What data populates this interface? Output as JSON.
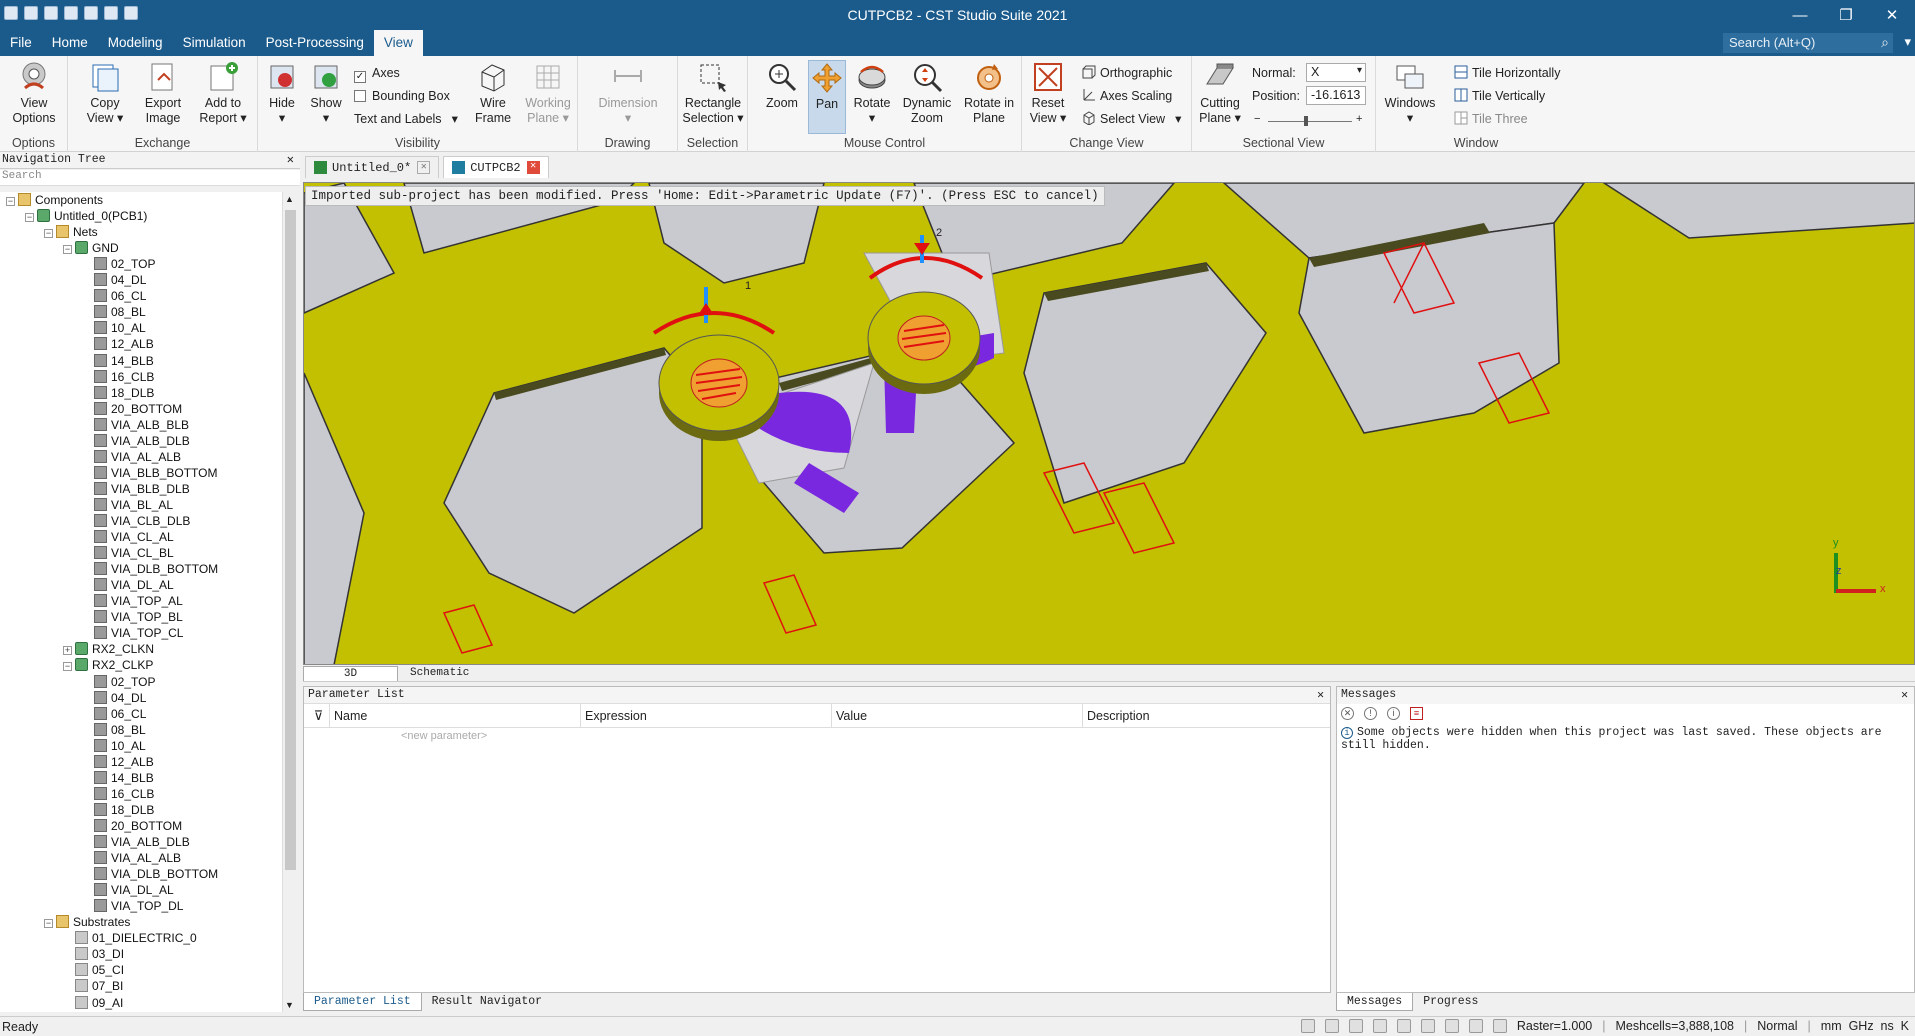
{
  "window": {
    "title": "CUTPCB2 - CST Studio Suite 2021",
    "min": "—",
    "max": "❐",
    "close": "✕"
  },
  "menu": {
    "tabs": [
      "File",
      "Home",
      "Modeling",
      "Simulation",
      "Post-Processing",
      "View"
    ],
    "active": "View",
    "search_placeholder": "Search (Alt+Q)"
  },
  "ribbon": {
    "groups": {
      "options": "Options",
      "exchange": "Exchange",
      "visibility": "Visibility",
      "drawing": "Drawing",
      "selection": "Selection",
      "mouse_control": "Mouse Control",
      "change_view": "Change View",
      "sectional_view": "Sectional View",
      "window": "Window"
    },
    "view_options": [
      "View",
      "Options"
    ],
    "copy_view": [
      "Copy",
      "View ▾"
    ],
    "export_image": [
      "Export",
      "Image"
    ],
    "add_to_report": [
      "Add to",
      "Report ▾"
    ],
    "hide": [
      "Hide",
      "▾"
    ],
    "show": [
      "Show",
      "▾"
    ],
    "axes": "Axes",
    "bounding_box": "Bounding Box",
    "text_and_labels": "Text and Labels",
    "wire_frame": [
      "Wire",
      "Frame"
    ],
    "working_plane": [
      "Working",
      "Plane ▾"
    ],
    "dimension": [
      "Dimension",
      "▾"
    ],
    "rectangle_selection": [
      "Rectangle",
      "Selection ▾"
    ],
    "zoom": "Zoom",
    "pan": "Pan",
    "rotate": [
      "Rotate",
      "▾"
    ],
    "dynamic_zoom": [
      "Dynamic",
      "Zoom"
    ],
    "rotate_in_plane": [
      "Rotate in",
      "Plane"
    ],
    "reset_view": [
      "Reset",
      "View ▾"
    ],
    "orthographic": "Orthographic",
    "axes_scaling": "Axes Scaling",
    "select_view": "Select View",
    "cutting_plane": [
      "Cutting",
      "Plane ▾"
    ],
    "normal_label": "Normal:",
    "normal_value": "X",
    "position_label": "Position:",
    "position_value": "-16.1613",
    "windows": [
      "Windows",
      "▾"
    ],
    "tile_horizontally": "Tile Horizontally",
    "tile_vertically": "Tile Vertically",
    "tile_three": "Tile Three"
  },
  "nav": {
    "title": "Navigation Tree",
    "search_placeholder": "Search",
    "items": [
      {
        "label": "Components",
        "indent": 0,
        "exp": "−",
        "icon": "folder"
      },
      {
        "label": "Untitled_0(PCB1)",
        "indent": 1,
        "exp": "−",
        "icon": "net"
      },
      {
        "label": "Nets",
        "indent": 2,
        "exp": "−",
        "icon": "folder"
      },
      {
        "label": "GND",
        "indent": 3,
        "exp": "−",
        "icon": "net"
      },
      {
        "label": "02_TOP",
        "indent": 4,
        "icon": "comp"
      },
      {
        "label": "04_DL",
        "indent": 4,
        "icon": "comp"
      },
      {
        "label": "06_CL",
        "indent": 4,
        "icon": "comp"
      },
      {
        "label": "08_BL",
        "indent": 4,
        "icon": "comp"
      },
      {
        "label": "10_AL",
        "indent": 4,
        "icon": "comp"
      },
      {
        "label": "12_ALB",
        "indent": 4,
        "icon": "comp"
      },
      {
        "label": "14_BLB",
        "indent": 4,
        "icon": "comp"
      },
      {
        "label": "16_CLB",
        "indent": 4,
        "icon": "comp"
      },
      {
        "label": "18_DLB",
        "indent": 4,
        "icon": "comp"
      },
      {
        "label": "20_BOTTOM",
        "indent": 4,
        "icon": "comp"
      },
      {
        "label": "VIA_ALB_BLB",
        "indent": 4,
        "icon": "comp"
      },
      {
        "label": "VIA_ALB_DLB",
        "indent": 4,
        "icon": "comp"
      },
      {
        "label": "VIA_AL_ALB",
        "indent": 4,
        "icon": "comp"
      },
      {
        "label": "VIA_BLB_BOTTOM",
        "indent": 4,
        "icon": "comp"
      },
      {
        "label": "VIA_BLB_DLB",
        "indent": 4,
        "icon": "comp"
      },
      {
        "label": "VIA_BL_AL",
        "indent": 4,
        "icon": "comp"
      },
      {
        "label": "VIA_CLB_DLB",
        "indent": 4,
        "icon": "comp"
      },
      {
        "label": "VIA_CL_AL",
        "indent": 4,
        "icon": "comp"
      },
      {
        "label": "VIA_CL_BL",
        "indent": 4,
        "icon": "comp"
      },
      {
        "label": "VIA_DLB_BOTTOM",
        "indent": 4,
        "icon": "comp"
      },
      {
        "label": "VIA_DL_AL",
        "indent": 4,
        "icon": "comp"
      },
      {
        "label": "VIA_TOP_AL",
        "indent": 4,
        "icon": "comp"
      },
      {
        "label": "VIA_TOP_BL",
        "indent": 4,
        "icon": "comp"
      },
      {
        "label": "VIA_TOP_CL",
        "indent": 4,
        "icon": "comp"
      },
      {
        "label": "RX2_CLKN",
        "indent": 3,
        "exp": "+",
        "icon": "net"
      },
      {
        "label": "RX2_CLKP",
        "indent": 3,
        "exp": "−",
        "icon": "net"
      },
      {
        "label": "02_TOP",
        "indent": 4,
        "icon": "comp"
      },
      {
        "label": "04_DL",
        "indent": 4,
        "icon": "comp"
      },
      {
        "label": "06_CL",
        "indent": 4,
        "icon": "comp"
      },
      {
        "label": "08_BL",
        "indent": 4,
        "icon": "comp"
      },
      {
        "label": "10_AL",
        "indent": 4,
        "icon": "comp"
      },
      {
        "label": "12_ALB",
        "indent": 4,
        "icon": "comp"
      },
      {
        "label": "14_BLB",
        "indent": 4,
        "icon": "comp"
      },
      {
        "label": "16_CLB",
        "indent": 4,
        "icon": "comp"
      },
      {
        "label": "18_DLB",
        "indent": 4,
        "icon": "comp"
      },
      {
        "label": "20_BOTTOM",
        "indent": 4,
        "icon": "comp"
      },
      {
        "label": "VIA_ALB_DLB",
        "indent": 4,
        "icon": "comp"
      },
      {
        "label": "VIA_AL_ALB",
        "indent": 4,
        "icon": "comp"
      },
      {
        "label": "VIA_DLB_BOTTOM",
        "indent": 4,
        "icon": "comp"
      },
      {
        "label": "VIA_DL_AL",
        "indent": 4,
        "icon": "comp"
      },
      {
        "label": "VIA_TOP_DL",
        "indent": 4,
        "icon": "comp"
      },
      {
        "label": "Substrates",
        "indent": 2,
        "exp": "−",
        "icon": "folder"
      },
      {
        "label": "01_DIELECTRIC_0",
        "indent": 3,
        "icon": "sub"
      },
      {
        "label": "03_DI",
        "indent": 3,
        "icon": "sub"
      },
      {
        "label": "05_CI",
        "indent": 3,
        "icon": "sub"
      },
      {
        "label": "07_BI",
        "indent": 3,
        "icon": "sub"
      },
      {
        "label": "09_AI",
        "indent": 3,
        "icon": "sub"
      }
    ]
  },
  "doc_tabs": [
    {
      "label": "Untitled_0*",
      "active": false
    },
    {
      "label": "CUTPCB2",
      "active": true
    }
  ],
  "viewport": {
    "banner": "Imported sub-project has been modified. Press 'Home: Edit->Parametric Update (F7)'. (Press ESC to cancel)",
    "port_labels": [
      "1",
      "2"
    ],
    "axis_labels": {
      "x": "x",
      "y": "y",
      "z": "z"
    },
    "colors": {
      "board": "#c2c000",
      "hole": "#c8c8d0",
      "pad": "#a8a800",
      "trace": "#7a28e0",
      "port": "#e01010",
      "bg": "#d4d4d4"
    }
  },
  "view_subtabs": [
    "3D",
    "Schematic"
  ],
  "param": {
    "title": "Parameter List",
    "columns": [
      "Name",
      "Expression",
      "Value",
      "Description"
    ],
    "new_param": "<new parameter>",
    "tabs": [
      "Parameter List",
      "Result Navigator"
    ]
  },
  "messages": {
    "title": "Messages",
    "line": "Some objects were hidden when this project was last saved. These objects are still hidden.",
    "tabs": [
      "Messages",
      "Progress"
    ]
  },
  "status": {
    "left": "Ready",
    "raster": "Raster=1.000",
    "meshcells": "Meshcells=3,888,108",
    "mode": "Normal",
    "units": "mm  GHz  ns  K"
  }
}
